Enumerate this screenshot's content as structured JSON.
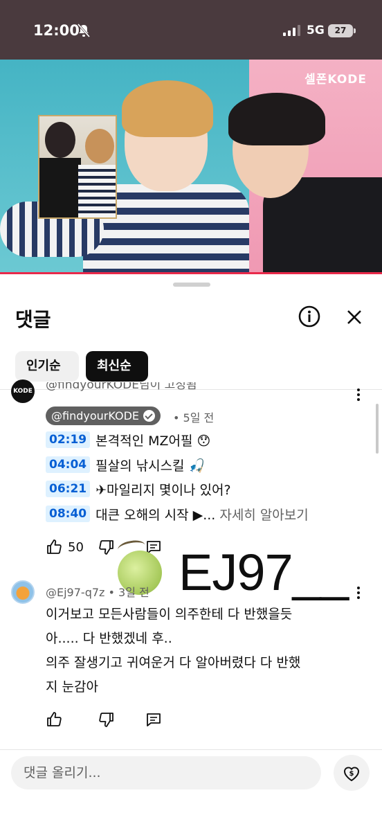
{
  "status_bar": {
    "time": "12:00",
    "network": "5G",
    "battery": "27",
    "icons": [
      "bell-off-icon",
      "signal-icon",
      "battery-icon"
    ]
  },
  "video": {
    "channel_logo": "셀폰KODE"
  },
  "comments_sheet": {
    "title": "댓글",
    "sort_chips": [
      "인기순",
      "최신순"
    ],
    "selected_sort": "최신순",
    "comments": [
      {
        "reply_line": "@findyourKODE님이 고정됨",
        "author": "@findyourKODE",
        "time": "5일 전",
        "timestamps": [
          {
            "time": "02:19",
            "text": "본격적인 MZ어필 😯"
          },
          {
            "time": "04:04",
            "text": "필살의 낚시스킬 🎣"
          },
          {
            "time": "06:21",
            "text": "✈마일리지 몇이나 있어?"
          },
          {
            "time": "08:40",
            "text": "대큰 오해의 시작 ▶..."
          }
        ],
        "more_link": "자세히 알아보기",
        "likes": "50"
      },
      {
        "author": "@Ej97-q7z",
        "time": "3일 전",
        "body_lines": [
          "이거보고 모든사람들이 의주한테 다 반했을듯",
          "아..... 다 반했겠네 후..",
          "의주 잘생기고 귀여운거 다 알아버렸다 다 반했",
          "지 눈감아"
        ]
      }
    ],
    "composer_placeholder": "댓글 올리기..."
  },
  "watermark": {
    "text": "EJ97__"
  }
}
